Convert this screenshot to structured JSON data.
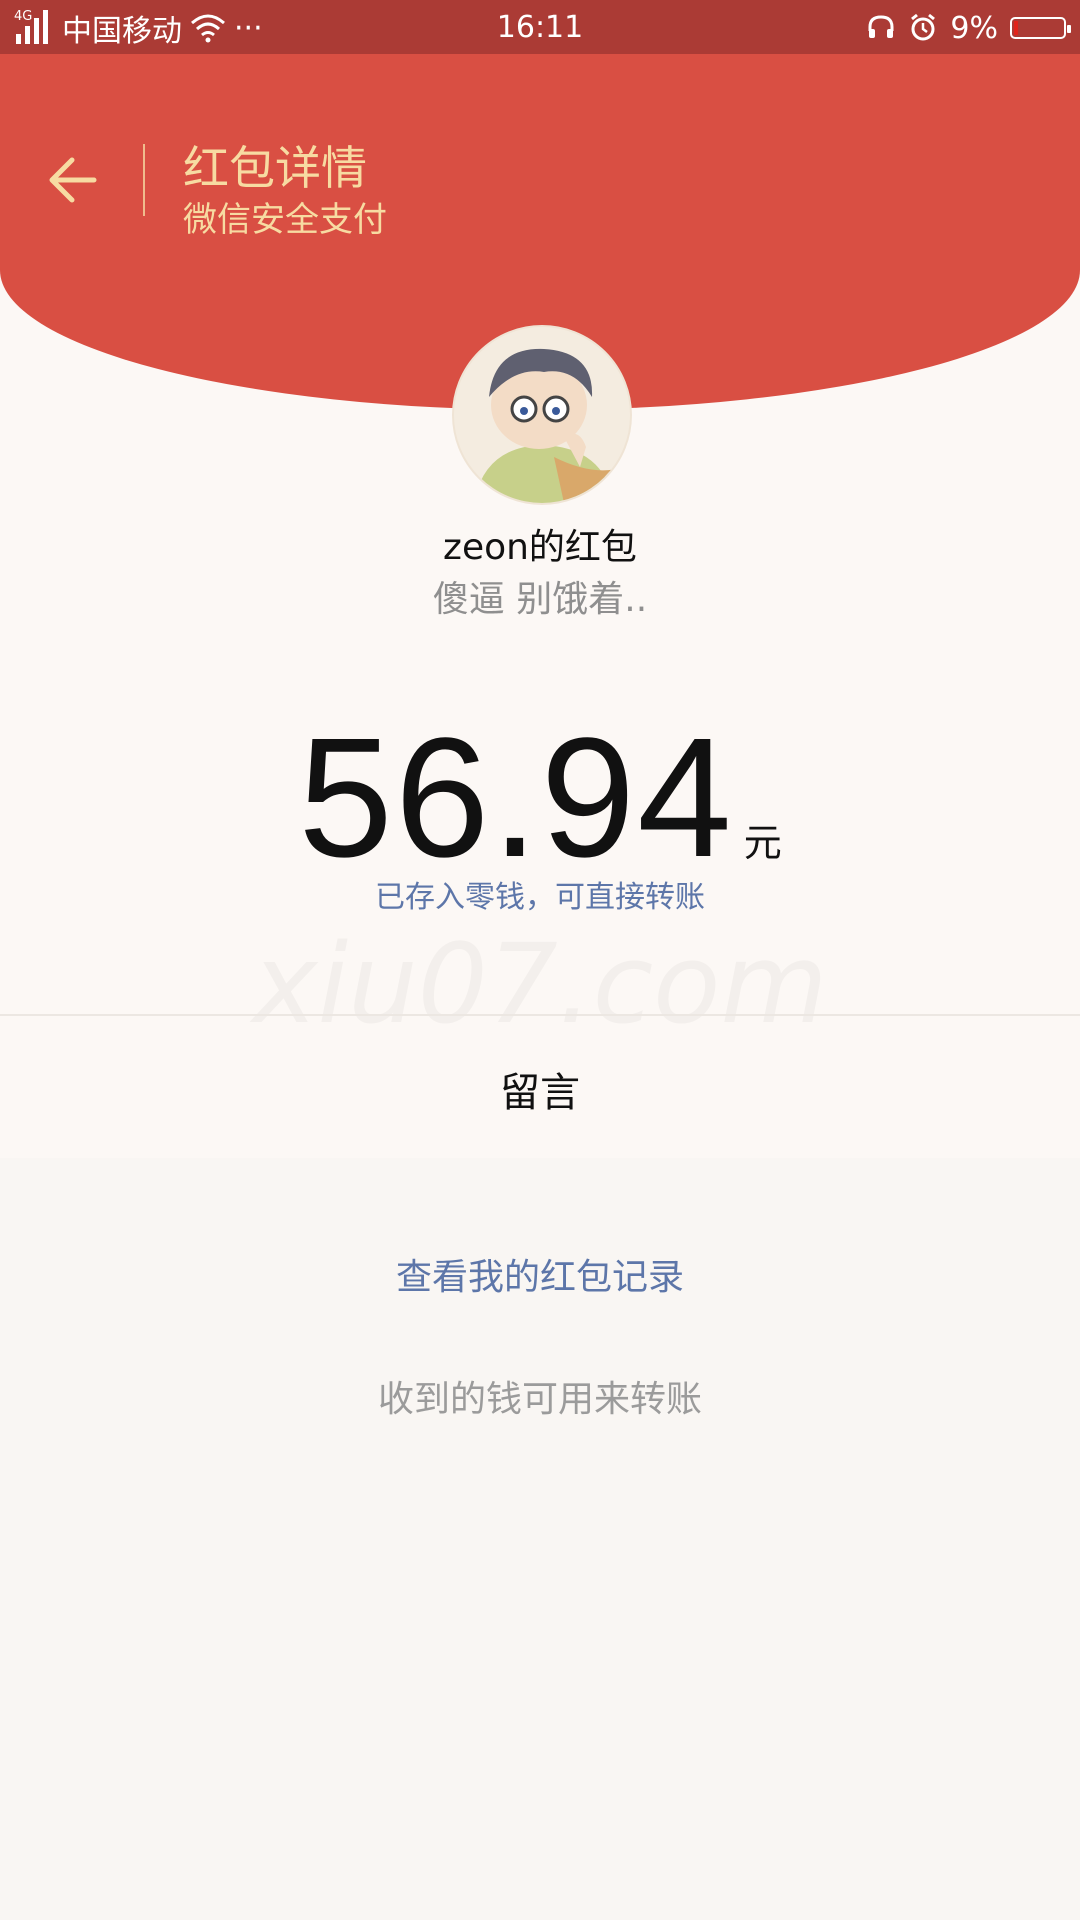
{
  "status_bar": {
    "network": "4G",
    "carrier": "中国移动",
    "more": "···",
    "time": "16:11",
    "battery_percent": "9%",
    "battery_level": 0.09,
    "icons": [
      "signal-icon",
      "wifi-icon",
      "headset-icon",
      "alarm-icon",
      "battery-icon"
    ]
  },
  "header": {
    "title": "红包详情",
    "subtitle": "微信安全支付",
    "back_icon": "arrow-left-icon",
    "colors": {
      "bg": "#d94f43",
      "text": "#f7dba2"
    }
  },
  "packet": {
    "sender": "zeon的红包",
    "wish": "傻逼 别饿着..",
    "amount": "56.94",
    "unit": "元",
    "note": "已存入零钱，可直接转账",
    "watermark": "xiu07.com"
  },
  "message": {
    "label": "留言"
  },
  "links": {
    "records": "查看我的红包记录",
    "hint": "收到的钱可用来转账"
  }
}
